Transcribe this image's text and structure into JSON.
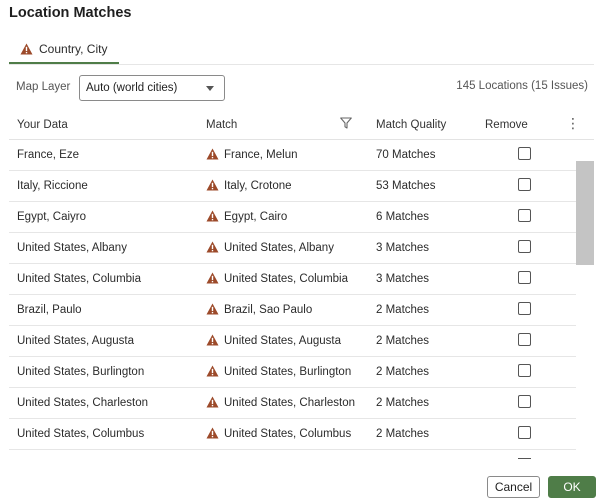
{
  "dialog": {
    "title": "Location Matches"
  },
  "tabs": [
    {
      "label": "Country, City",
      "icon": "warning-icon"
    }
  ],
  "map_layer": {
    "label": "Map Layer",
    "value": "Auto (world cities)"
  },
  "location_count": "145 Locations (15 Issues)",
  "table": {
    "headers": {
      "your_data": "Your Data",
      "match": "Match",
      "match_quality": "Match Quality",
      "remove": "Remove",
      "more": "⋮"
    },
    "rows": [
      {
        "your_data": "France, Eze",
        "match": "France, Melun",
        "quality": "70 Matches"
      },
      {
        "your_data": "Italy, Riccione",
        "match": "Italy, Crotone",
        "quality": "53 Matches"
      },
      {
        "your_data": "Egypt, Caiyro",
        "match": "Egypt, Cairo",
        "quality": "6 Matches"
      },
      {
        "your_data": "United States, Albany",
        "match": "United States, Albany",
        "quality": "3 Matches"
      },
      {
        "your_data": "United States, Columbia",
        "match": "United States, Columbia",
        "quality": "3 Matches"
      },
      {
        "your_data": "Brazil, Paulo",
        "match": "Brazil, Sao Paulo",
        "quality": "2 Matches"
      },
      {
        "your_data": "United States, Augusta",
        "match": "United States, Augusta",
        "quality": "2 Matches"
      },
      {
        "your_data": "United States, Burlington",
        "match": "United States, Burlington",
        "quality": "2 Matches"
      },
      {
        "your_data": "United States, Charleston",
        "match": "United States, Charleston",
        "quality": "2 Matches"
      },
      {
        "your_data": "United States, Columbus",
        "match": "United States, Columbus",
        "quality": "2 Matches"
      }
    ]
  },
  "buttons": {
    "cancel": "Cancel",
    "ok": "OK"
  },
  "colors": {
    "accent": "#4f7d48",
    "warning": "#9c4a2a"
  }
}
